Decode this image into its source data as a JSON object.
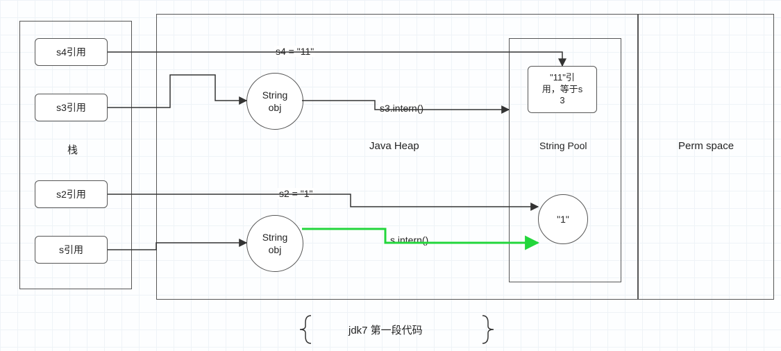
{
  "stack": {
    "title": "栈",
    "s4": "s4引用",
    "s3": "s3引用",
    "s2": "s2引用",
    "s": "s引用"
  },
  "heap": {
    "title": "Java Heap",
    "stringObj1": "String\nobj",
    "stringObj2": "String\nobj",
    "s4Assign": "s4 = \"11\"",
    "s3Intern": "s3.intern()",
    "s2Assign": "s2 = \"1\"",
    "sIntern": "s.intern()"
  },
  "pool": {
    "title": "String Pool",
    "ref11": "\"11\"引\n用，等于s\n3",
    "literal1": "\"1\""
  },
  "perm": {
    "title": "Perm space"
  },
  "footer": "jdk7 第一段代码"
}
